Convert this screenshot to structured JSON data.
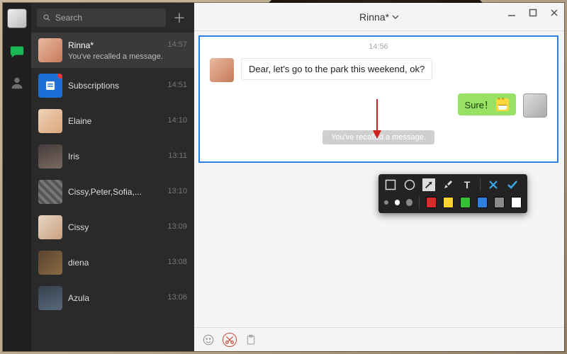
{
  "search": {
    "placeholder": "Search"
  },
  "sidebar": {
    "items": [
      {
        "name": "Rinna*",
        "time": "14:57",
        "preview": "You've recalled a message."
      },
      {
        "name": "Subscriptions",
        "time": "14:51",
        "preview": ""
      },
      {
        "name": "Elaine",
        "time": "14:10",
        "preview": ""
      },
      {
        "name": "Iris",
        "time": "13:11",
        "preview": ""
      },
      {
        "name": "Cissy,Peter,Sofia,...",
        "time": "13:10",
        "preview": ""
      },
      {
        "name": "Cissy",
        "time": "13:09",
        "preview": ""
      },
      {
        "name": "diena",
        "time": "13:08",
        "preview": ""
      },
      {
        "name": "Azula",
        "time": "13:06",
        "preview": ""
      }
    ]
  },
  "chat": {
    "title": "Rinna*",
    "timestamp": "14:56",
    "incoming": "Dear, let's go to the park this weekend, ok?",
    "outgoing": "Sure！",
    "recall_notice": "You've recalled a message."
  },
  "snip": {
    "colors": [
      "#d92b2b",
      "#ffd22e",
      "#34c234",
      "#2f7fe0",
      "#8a8a8a",
      "#ffffff"
    ]
  }
}
